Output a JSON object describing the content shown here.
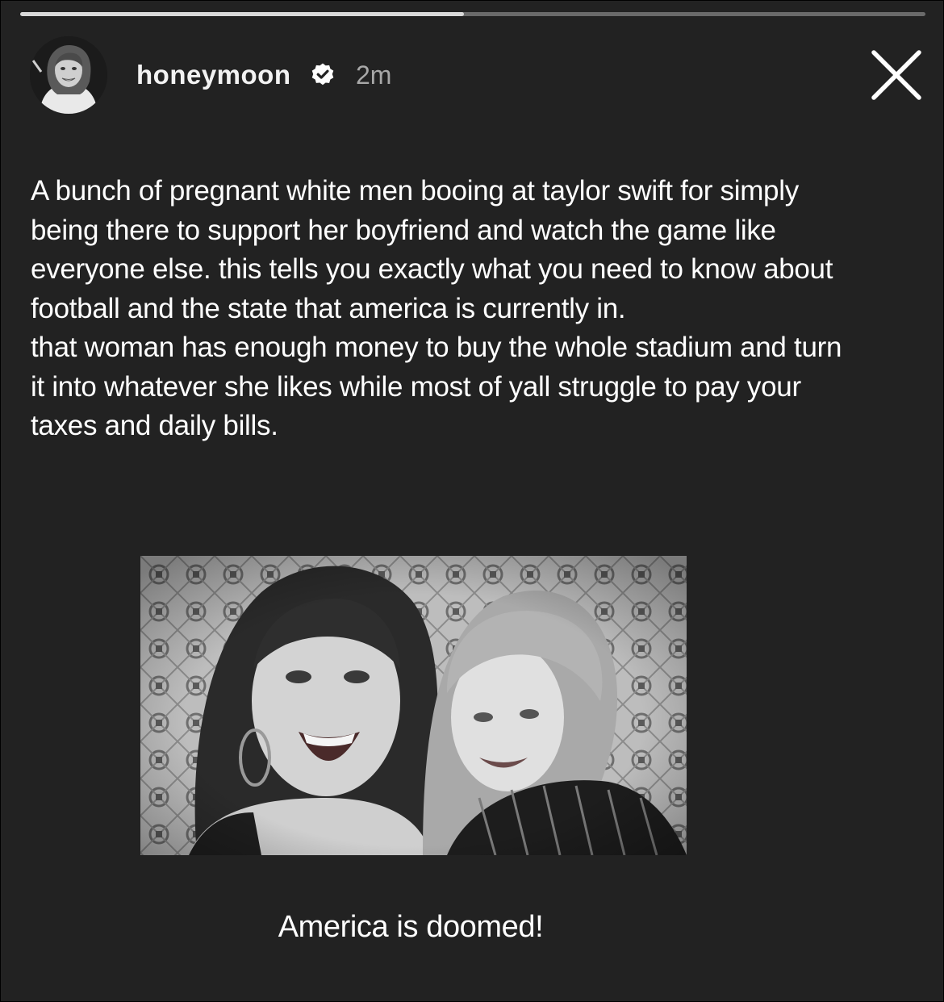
{
  "story": {
    "progress": 0.49,
    "username": "honeymoon",
    "verified_icon": "verified-badge-icon",
    "timestamp": "2m",
    "close_icon": "close-icon"
  },
  "post": {
    "paragraphs": [
      "A bunch of pregnant white men booing at taylor swift for simply being there to support her boyfriend and watch the game like everyone else. this tells you exactly what you need to know about football and the state that america is currently in.",
      "that woman has enough money to buy the whole stadium and turn it into whatever she likes while most of yall struggle to pay your taxes and daily bills."
    ],
    "caption": "America is doomed!"
  },
  "colors": {
    "background": "#222222",
    "progress_fill": "#d9d9d9",
    "progress_track": "#6a6a6a",
    "timestamp": "#a8a8a8"
  }
}
